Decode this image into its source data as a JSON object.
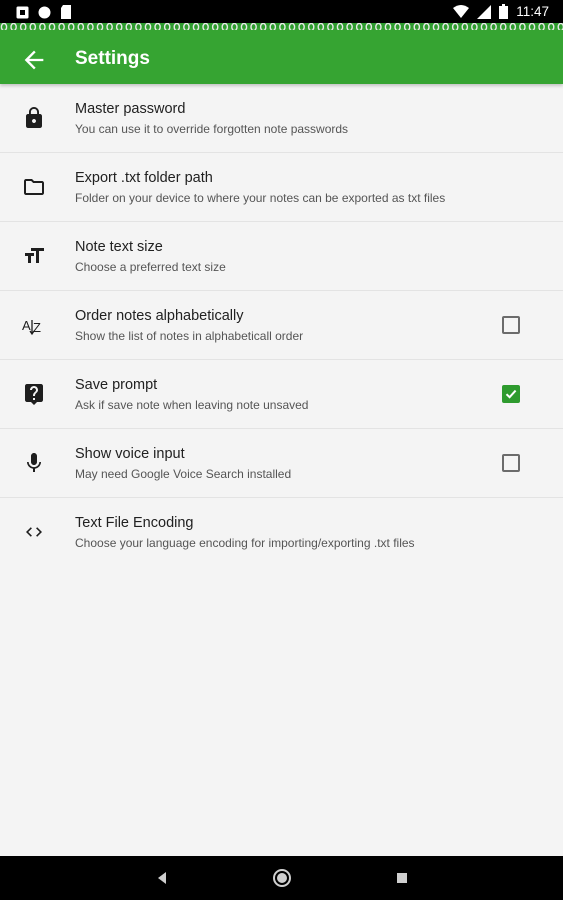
{
  "status_bar": {
    "time": "11:47",
    "left_icons": [
      "notification-icon",
      "circle-icon",
      "sd-card-icon"
    ],
    "right_icons": [
      "wifi-icon",
      "signal-icon",
      "battery-icon"
    ]
  },
  "app_bar": {
    "title": "Settings",
    "back_icon": "arrow-back-icon",
    "color": "#36a432"
  },
  "settings": [
    {
      "title": "Master password",
      "subtitle": "You can use it to override forgotten note passwords",
      "icon": "lock-icon"
    },
    {
      "title": "Export .txt folder path",
      "subtitle": "Folder on your device to where your notes can be exported as txt files",
      "icon": "folder-icon"
    },
    {
      "title": "Note text size",
      "subtitle": "Choose a preferred text size",
      "icon": "text-size-icon"
    },
    {
      "title": "Order notes alphabetically",
      "subtitle": "Show the list of notes in alphabeticall order",
      "icon": "sort-alpha-icon",
      "checkbox": true,
      "checked": false
    },
    {
      "title": "Save prompt",
      "subtitle": "Ask if save note when leaving note unsaved",
      "icon": "help-icon",
      "checkbox": true,
      "checked": true
    },
    {
      "title": "Show voice input",
      "subtitle": "May need Google Voice Search installed",
      "icon": "mic-icon",
      "checkbox": true,
      "checked": false
    },
    {
      "title": "Text File Encoding",
      "subtitle": "Choose your language encoding for importing/exporting .txt files",
      "icon": "code-icon"
    }
  ],
  "nav_bar": {
    "icons": [
      "nav-back-icon",
      "nav-home-icon",
      "nav-recents-icon"
    ]
  },
  "colors": {
    "accent": "#36a432",
    "checkbox_checked": "#2e9b2e",
    "background": "#f4f4f4"
  }
}
